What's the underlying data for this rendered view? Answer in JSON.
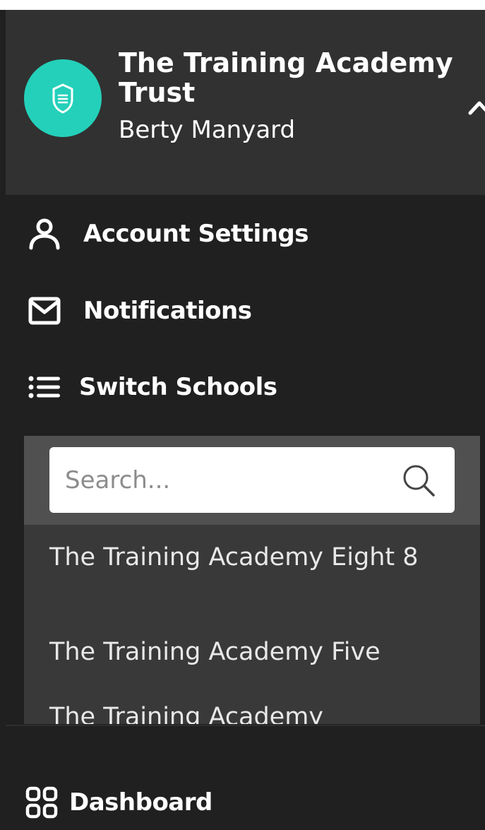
{
  "header": {
    "org_name": "The Training Academy Trust",
    "user_name": "Berty Manyard",
    "avatar_icon": "shield-icon",
    "accent_color": "#24d0b9"
  },
  "menu": {
    "items": [
      {
        "label": "Account Settings",
        "icon": "user-icon"
      },
      {
        "label": "Notifications",
        "icon": "envelope-icon"
      },
      {
        "label": "Switch Schools",
        "icon": "list-icon"
      }
    ]
  },
  "switch_schools": {
    "search_placeholder": "Search...",
    "schools": [
      "The Training Academy Eight 8",
      "The Training Academy Five",
      "The Training Academy"
    ]
  },
  "footer": {
    "dashboard_label": "Dashboard",
    "dashboard_icon": "grid-icon"
  }
}
